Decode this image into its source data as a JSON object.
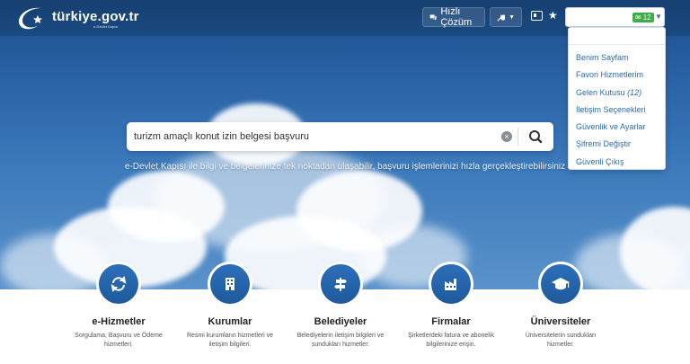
{
  "brand": {
    "name": "türkiye.gov.tr",
    "tagline": "e-Devlet Kapısı"
  },
  "toolbar": {
    "quick_label": "Hızlı Çözüm",
    "mail_count": "12"
  },
  "user_menu": {
    "items": [
      {
        "label": "Benim Sayfam"
      },
      {
        "label": "Favori Hizmetlerim"
      },
      {
        "label": "Gelen Kutusu",
        "count": "(12)"
      },
      {
        "label": "İletişim Seçenekleri"
      },
      {
        "label": "Güvenlik ve Ayarlar"
      },
      {
        "label": "Şifremi Değiştir"
      },
      {
        "label": "Güvenli Çıkış"
      }
    ]
  },
  "search": {
    "value": "turizm amaçlı konut izin belgesi başvuru"
  },
  "hero": {
    "tagline": "e-Devlet Kapısı ile bilgi ve belgelerinize tek noktadan ulaşabilir, başvuru işlemlerinizi hızla gerçekleştirebilirsiniz"
  },
  "categories": [
    {
      "title": "e-Hizmetler",
      "desc": "Sorgulama, Başvuru ve Ödeme hizmetleri.",
      "icon": "refresh-icon"
    },
    {
      "title": "Kurumlar",
      "desc": "Resmi kurumların hizmetleri ve iletişim bilgileri.",
      "icon": "building-icon"
    },
    {
      "title": "Belediyeler",
      "desc": "Belediyelerin iletişim bilgileri ve sundukları hizmetler.",
      "icon": "signpost-icon"
    },
    {
      "title": "Firmalar",
      "desc": "Şirketlerdeki fatura ve abonelik bilgilerinize erişin.",
      "icon": "factory-icon"
    },
    {
      "title": "Üniversiteler",
      "desc": "Üniversitelerin sundukları hizmetler.",
      "icon": "graduation-cap-icon"
    }
  ],
  "colors": {
    "primary": "#1e5a9c",
    "link": "#2b6cb0",
    "badge": "#3fae49"
  }
}
